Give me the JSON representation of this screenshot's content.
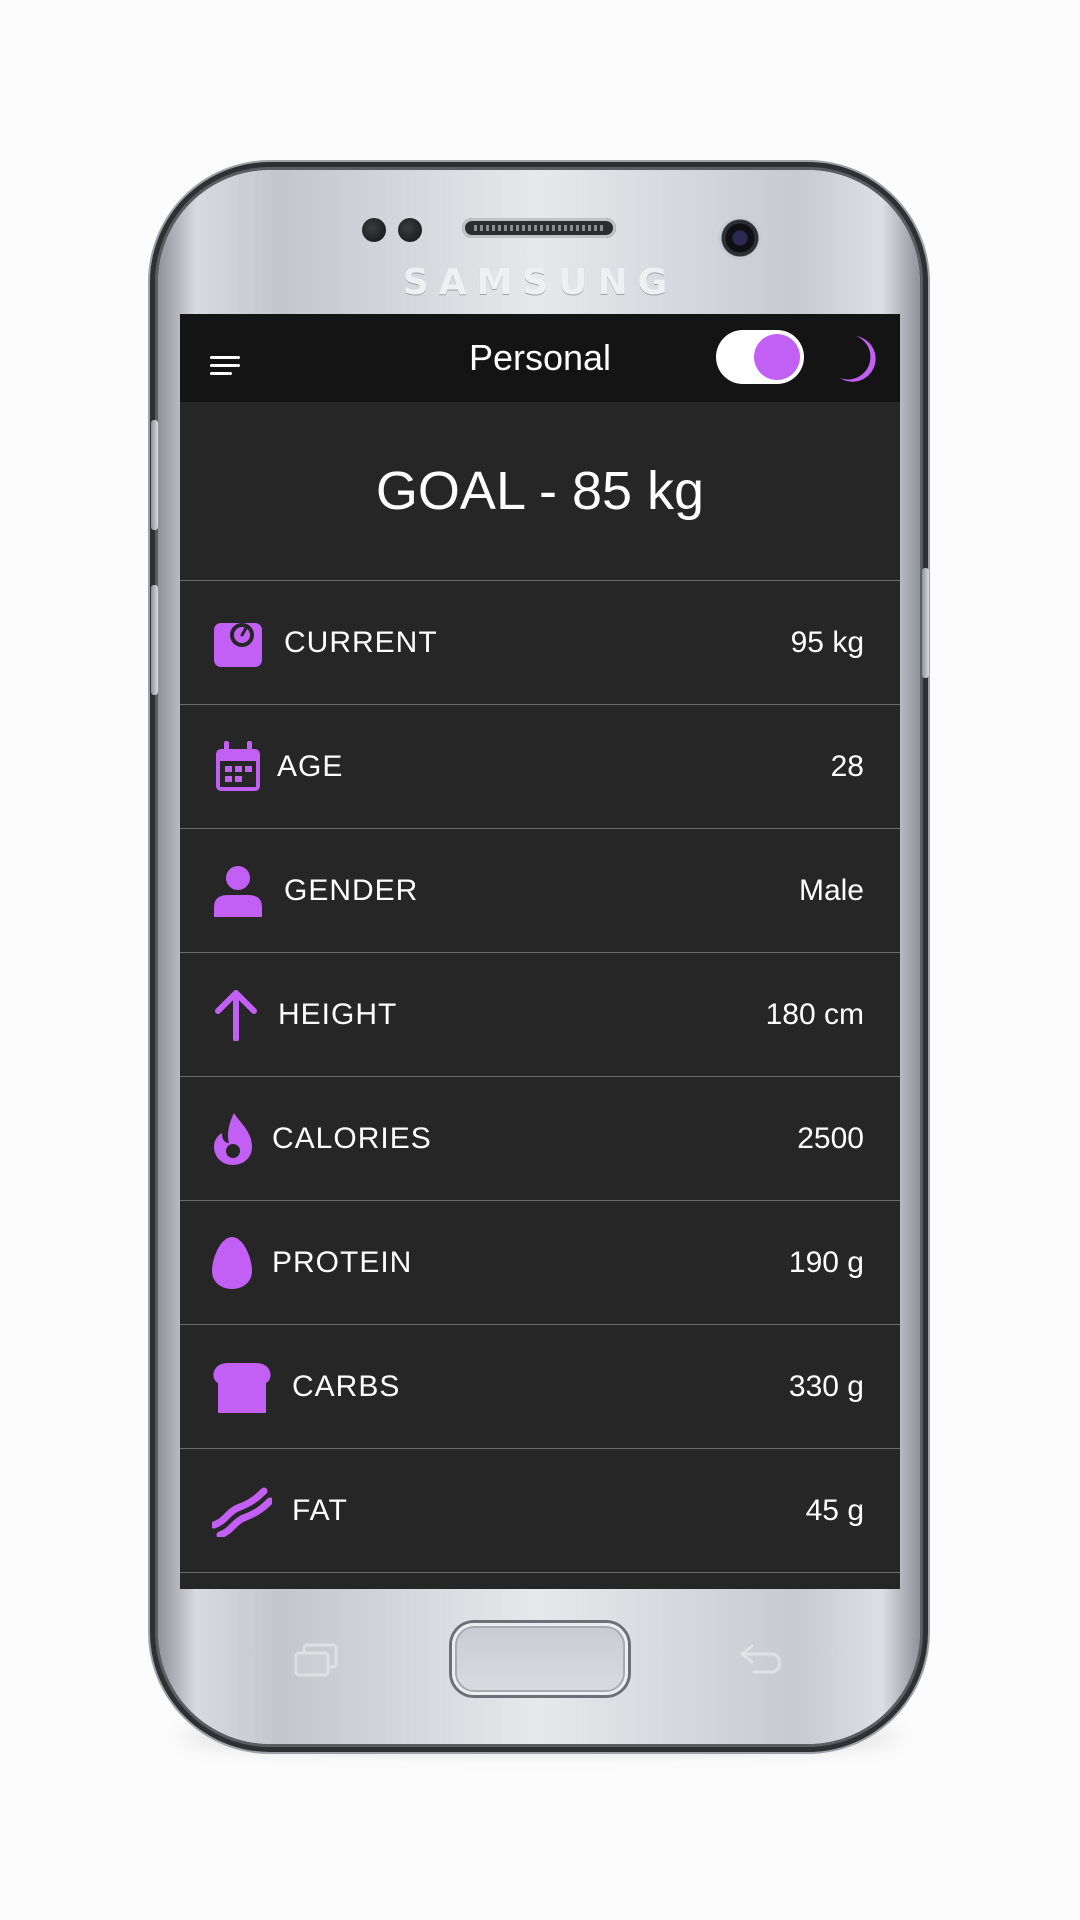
{
  "device": {
    "brand": "SAMSUNG"
  },
  "app_bar": {
    "menu_icon": "hamburger-menu-icon",
    "title": "Personal",
    "theme_toggle": {
      "state": "on"
    },
    "moon_icon": "moon-icon"
  },
  "goal": {
    "text": "GOAL - 85 kg"
  },
  "rows": [
    {
      "label": "CURRENT",
      "value": "95 kg",
      "icon": "scale-icon"
    },
    {
      "label": "AGE",
      "value": "28",
      "icon": "calendar-icon"
    },
    {
      "label": "GENDER",
      "value": "Male",
      "icon": "person-icon"
    },
    {
      "label": "HEIGHT",
      "value": "180 cm",
      "icon": "arrow-up-icon"
    },
    {
      "label": "CALORIES",
      "value": "2500",
      "icon": "flame-icon"
    },
    {
      "label": "PROTEIN",
      "value": "190 g",
      "icon": "egg-icon"
    },
    {
      "label": "CARBS",
      "value": "330 g",
      "icon": "bread-icon"
    },
    {
      "label": "FAT",
      "value": "45 g",
      "icon": "bacon-icon"
    }
  ],
  "colors": {
    "accent": "#c25ff5",
    "background": "#262626",
    "app_bar": "#141414"
  }
}
